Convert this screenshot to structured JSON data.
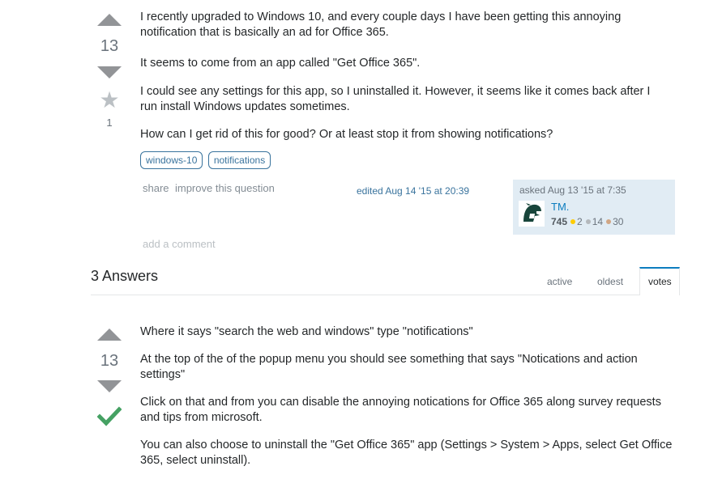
{
  "question": {
    "score": "13",
    "favorite_count": "1",
    "paragraphs": [
      "I recently upgraded to Windows 10, and every couple days I have been getting this annoying notification that is basically an ad for Office 365.",
      "It seems to come from an app called \"Get Office 365\".",
      "I could see any settings for this app, so I uninstalled it. However, it seems like it comes back after I run install Windows updates sometimes.",
      "How can I get rid of this for good? Or at least stop it from showing notifications?"
    ],
    "tags": [
      "windows-10",
      "notifications"
    ],
    "menu": {
      "share": "share",
      "improve": "improve this question"
    },
    "edited": "edited Aug 14 '15 at 20:39",
    "asked": "asked Aug 13 '15 at 7:35",
    "user": {
      "name": "TM.",
      "reputation": "745",
      "gold": "2",
      "silver": "14",
      "bronze": "30"
    },
    "add_comment": "add a comment"
  },
  "answers_header": {
    "count_label": "3 Answers",
    "tabs": [
      "active",
      "oldest",
      "votes"
    ],
    "selected_tab": "votes"
  },
  "answer": {
    "score": "13",
    "accepted": true,
    "paragraphs": [
      "Where it says \"search the web and windows\" type \"notifications\"",
      "At the top of the of the popup menu you should see something that says \"Notications and action settings\"",
      "Click on that and from you can disable the annoying notications for Office 365 along survey requests and tips from microsoft.",
      "You can also choose to uninstall the \"Get Office 365\" app (Settings > System > Apps, select Get Office 365, select uninstall)."
    ]
  },
  "colors": {
    "accent": "#0c7dbf",
    "tag": "#39739d",
    "accepted": "#45a163",
    "gold": "#ffcc01",
    "silver": "#b4b8bc",
    "bronze": "#d1a684",
    "usercard_bg": "#e1ecf4",
    "tab_active": "#f48024"
  },
  "icons": {
    "upvote": "triangle-up",
    "downvote": "triangle-down",
    "favorite": "star",
    "accepted": "checkmark",
    "avatar": "spartan-helmet"
  }
}
